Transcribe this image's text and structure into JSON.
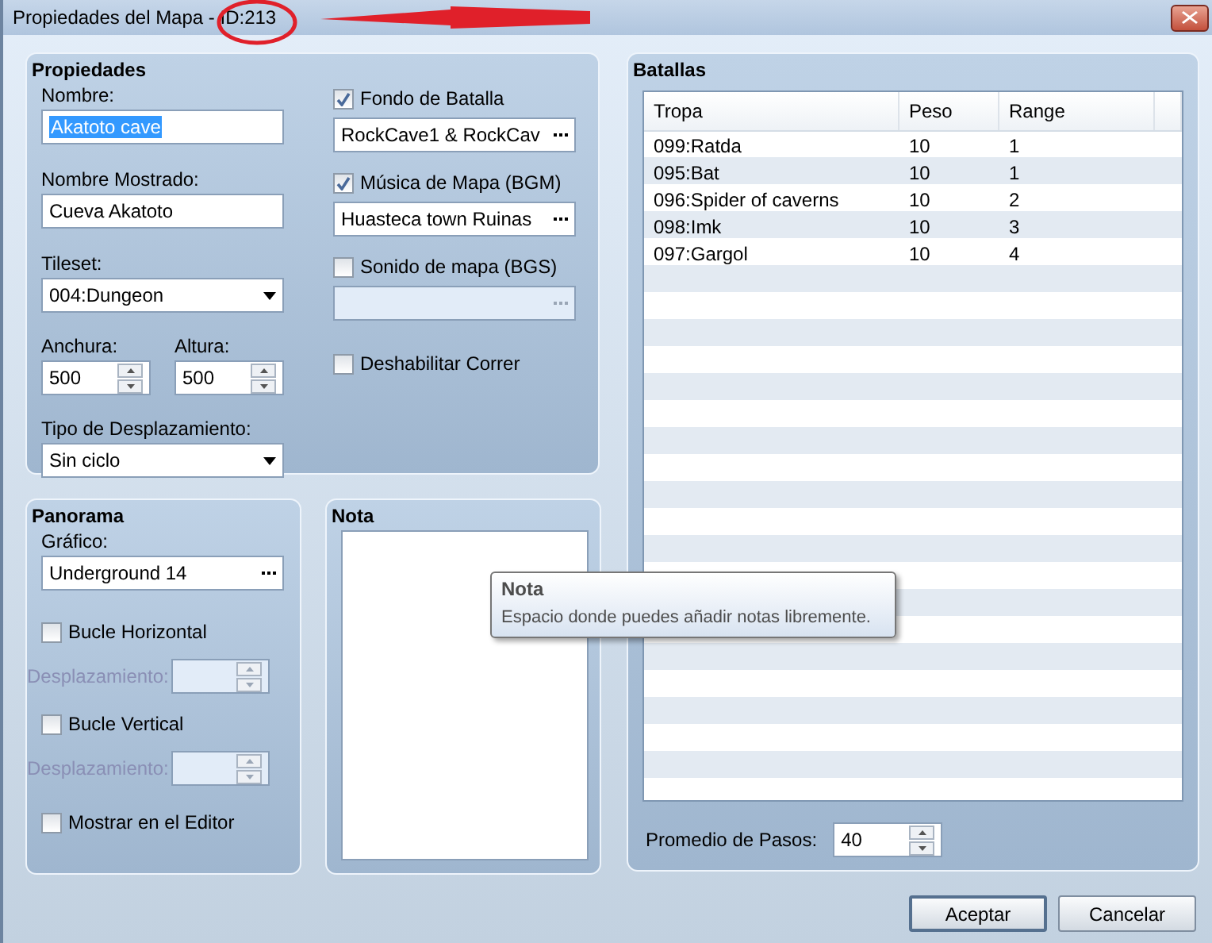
{
  "window": {
    "title": "Propiedades del Mapa - ID:213"
  },
  "properties": {
    "title": "Propiedades",
    "name": {
      "label": "Nombre:",
      "value": "Akatoto cave",
      "text_selected": true
    },
    "display_name": {
      "label": "Nombre Mostrado:",
      "value": "Cueva Akatoto"
    },
    "tileset": {
      "label": "Tileset:",
      "value": "004:Dungeon"
    },
    "width": {
      "label": "Anchura:",
      "value": "500"
    },
    "height": {
      "label": "Altura:",
      "value": "500"
    },
    "scroll_type": {
      "label": "Tipo de Desplazamiento:",
      "value": "Sin ciclo"
    },
    "options": [
      {
        "kind": "picker",
        "label": "Fondo de Batalla",
        "checked": true,
        "value": "RockCave1 & RockCav",
        "disabled": false
      },
      {
        "kind": "picker",
        "label": "Música de Mapa (BGM)",
        "checked": true,
        "value": "Huasteca town Ruinas",
        "disabled": false
      },
      {
        "kind": "picker",
        "label": "Sonido de mapa (BGS)",
        "checked": false,
        "disabled": true
      },
      {
        "kind": "check",
        "label": "Deshabilitar Correr",
        "checked": false
      }
    ]
  },
  "panorama": {
    "title": "Panorama",
    "graphic": {
      "label": "Gráfico:",
      "value": "Underground 14"
    },
    "loops": [
      {
        "label": "Bucle Horizontal",
        "checked": false,
        "offset_label": "Desplazamiento:",
        "disabled": true
      },
      {
        "label": "Bucle Vertical",
        "checked": false,
        "offset_label": "Desplazamiento:",
        "disabled": true
      }
    ],
    "show_in_editor": {
      "label": "Mostrar en el Editor",
      "checked": false
    }
  },
  "note": {
    "title": "Nota"
  },
  "battles": {
    "title": "Batallas",
    "columns": [
      "Tropa",
      "Peso",
      "Range"
    ],
    "rows": [
      [
        "099:Ratda",
        "10",
        "1"
      ],
      [
        "095:Bat",
        "10",
        "1"
      ],
      [
        "096:Spider of caverns",
        "10",
        "2"
      ],
      [
        "098:Imk",
        "10",
        "3"
      ],
      [
        "097:Gargol",
        "10",
        "4"
      ]
    ],
    "steps": {
      "label": "Promedio de Pasos:",
      "value": "40"
    }
  },
  "tooltip": {
    "title": "Nota",
    "text": "Espacio donde puedes añadir notas libremente."
  },
  "buttons": [
    {
      "label": "Aceptar",
      "default": true
    },
    {
      "label": "Cancelar",
      "default": false
    }
  ]
}
